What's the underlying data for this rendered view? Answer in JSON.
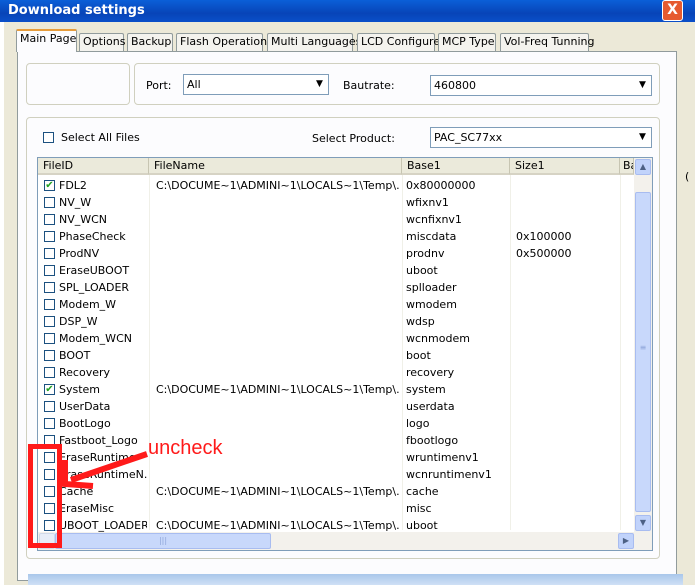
{
  "window": {
    "title": "Download settings",
    "close_glyph": "X"
  },
  "tabs": [
    {
      "label": "Main Page"
    },
    {
      "label": "Options"
    },
    {
      "label": "Backup"
    },
    {
      "label": "Flash Operations"
    },
    {
      "label": "Multi Languages"
    },
    {
      "label": "LCD Configure"
    },
    {
      "label": "MCP Type"
    },
    {
      "label": "Vol-Freq Tunning"
    }
  ],
  "port": {
    "label": "Port:",
    "value": "All"
  },
  "baudrate": {
    "label": "Bautrate:",
    "value": "460800"
  },
  "select_all": {
    "label": "Select All Files",
    "checked": false
  },
  "product": {
    "label": "Select Product:",
    "value": "PAC_SC77xx"
  },
  "list": {
    "columns": [
      "FileID",
      "FileName",
      "Base1",
      "Size1",
      "Ba"
    ],
    "rows": [
      {
        "checked": true,
        "id": "FDL2",
        "file": "C:\\DOCUME~1\\ADMINI~1\\LOCALS~1\\Temp\\...",
        "base": "0x80000000",
        "size": ""
      },
      {
        "checked": false,
        "id": "NV_W",
        "file": "",
        "base": "wfixnv1",
        "size": ""
      },
      {
        "checked": false,
        "id": "NV_WCN",
        "file": "",
        "base": "wcnfixnv1",
        "size": ""
      },
      {
        "checked": false,
        "id": "PhaseCheck",
        "file": "",
        "base": "miscdata",
        "size": "0x100000"
      },
      {
        "checked": false,
        "id": "ProdNV",
        "file": "",
        "base": "prodnv",
        "size": "0x500000"
      },
      {
        "checked": false,
        "id": "EraseUBOOT",
        "file": "",
        "base": "uboot",
        "size": ""
      },
      {
        "checked": false,
        "id": "SPL_LOADER",
        "file": "",
        "base": "splloader",
        "size": ""
      },
      {
        "checked": false,
        "id": "Modem_W",
        "file": "",
        "base": "wmodem",
        "size": ""
      },
      {
        "checked": false,
        "id": "DSP_W",
        "file": "",
        "base": "wdsp",
        "size": ""
      },
      {
        "checked": false,
        "id": "Modem_WCN",
        "file": "",
        "base": "wcnmodem",
        "size": ""
      },
      {
        "checked": false,
        "id": "BOOT",
        "file": "",
        "base": "boot",
        "size": ""
      },
      {
        "checked": false,
        "id": "Recovery",
        "file": "",
        "base": "recovery",
        "size": ""
      },
      {
        "checked": true,
        "id": "System",
        "file": "C:\\DOCUME~1\\ADMINI~1\\LOCALS~1\\Temp\\...",
        "base": "system",
        "size": ""
      },
      {
        "checked": false,
        "id": "UserData",
        "file": "",
        "base": "userdata",
        "size": ""
      },
      {
        "checked": false,
        "id": "BootLogo",
        "file": "",
        "base": "logo",
        "size": ""
      },
      {
        "checked": false,
        "id": "Fastboot_Logo",
        "file": "",
        "base": "fbootlogo",
        "size": ""
      },
      {
        "checked": false,
        "id": "EraseRuntime",
        "file": "",
        "base": "wruntimenv1",
        "size": ""
      },
      {
        "checked": false,
        "id": "EraseRuntimeN...",
        "file": "",
        "base": "wcnruntimenv1",
        "size": ""
      },
      {
        "checked": false,
        "id": "Cache",
        "file": "C:\\DOCUME~1\\ADMINI~1\\LOCALS~1\\Temp\\...",
        "base": "cache",
        "size": ""
      },
      {
        "checked": false,
        "id": "EraseMisc",
        "file": "",
        "base": "misc",
        "size": ""
      },
      {
        "checked": false,
        "id": "UBOOT_LOADER",
        "file": "C:\\DOCUME~1\\ADMINI~1\\LOCALS~1\\Temp\\...",
        "base": "uboot",
        "size": ""
      }
    ]
  },
  "annotation": {
    "text": "uncheck",
    "color": "#ff1a1a"
  },
  "icons": {
    "dropdown": "chevron-down-icon",
    "check": "checkmark-icon",
    "scroll_up": "arrow-up-icon",
    "scroll_down": "arrow-down-icon",
    "scroll_right": "arrow-right-icon"
  }
}
